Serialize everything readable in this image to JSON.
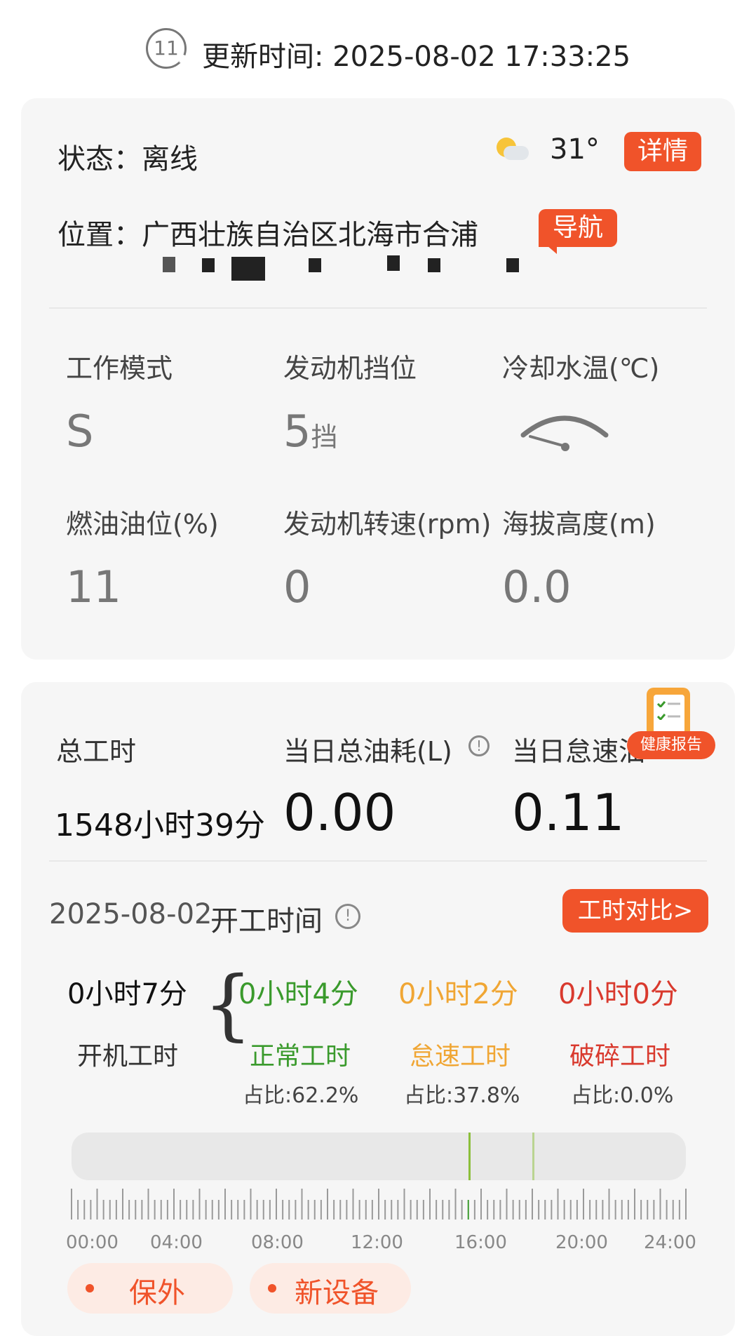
{
  "header": {
    "refresh_count": "11",
    "update_label": "更新时间: 2025-08-02 17:33:25"
  },
  "status": {
    "status_text": "状态：离线",
    "weather_icon": "partly-cloudy-icon",
    "temperature": "31°",
    "detail_label": "详情",
    "location_text": "位置：广西壮族自治区北海市合浦",
    "navigate_label": "导航"
  },
  "metrics": [
    {
      "label": "工作模式",
      "value": "S"
    },
    {
      "label": "发动机挡位",
      "value": "5",
      "unit": "挡"
    },
    {
      "label": "冷却水温(℃)",
      "value": ""
    },
    {
      "label": "燃油油位(%)",
      "value": "11"
    },
    {
      "label": "发动机转速(rpm)",
      "value": "0"
    },
    {
      "label": "海拔高度(m)",
      "value": "0.0"
    }
  ],
  "summary": {
    "total_hours_label": "总工时",
    "total_hours_value": "1548小时39分",
    "daily_fuel_label": "当日总油耗(L)",
    "daily_fuel_value": "0.00",
    "idle_fuel_label": "当日怠速油",
    "idle_fuel_value": "0.11",
    "health_report_label": "健康报告"
  },
  "worktime": {
    "date": "2025-08-02",
    "title": "开工时间",
    "compare_label": "工时对比>",
    "total_value": "0小时7分",
    "total_label": "开机工时",
    "normal_value": "0小时4分",
    "normal_label": "正常工时",
    "normal_ratio": "占比:62.2%",
    "idle_value": "0小时2分",
    "idle_label": "怠速工时",
    "idle_ratio": "占比:37.8%",
    "break_value": "0小时0分",
    "break_label": "破碎工时",
    "break_ratio": "占比:0.0%"
  },
  "timeline": {
    "ticks": [
      "00:00",
      "04:00",
      "08:00",
      "12:00",
      "16:00",
      "20:00",
      "24:00"
    ],
    "markers_hours": [
      15.5,
      18.0
    ],
    "marker_color": "#8bbf3a"
  },
  "tags": [
    "保外",
    "新设备"
  ],
  "colors": {
    "accent": "#f0532a",
    "normal": "#3a9a2c",
    "idle": "#f0a634",
    "break": "#d93a2e"
  }
}
